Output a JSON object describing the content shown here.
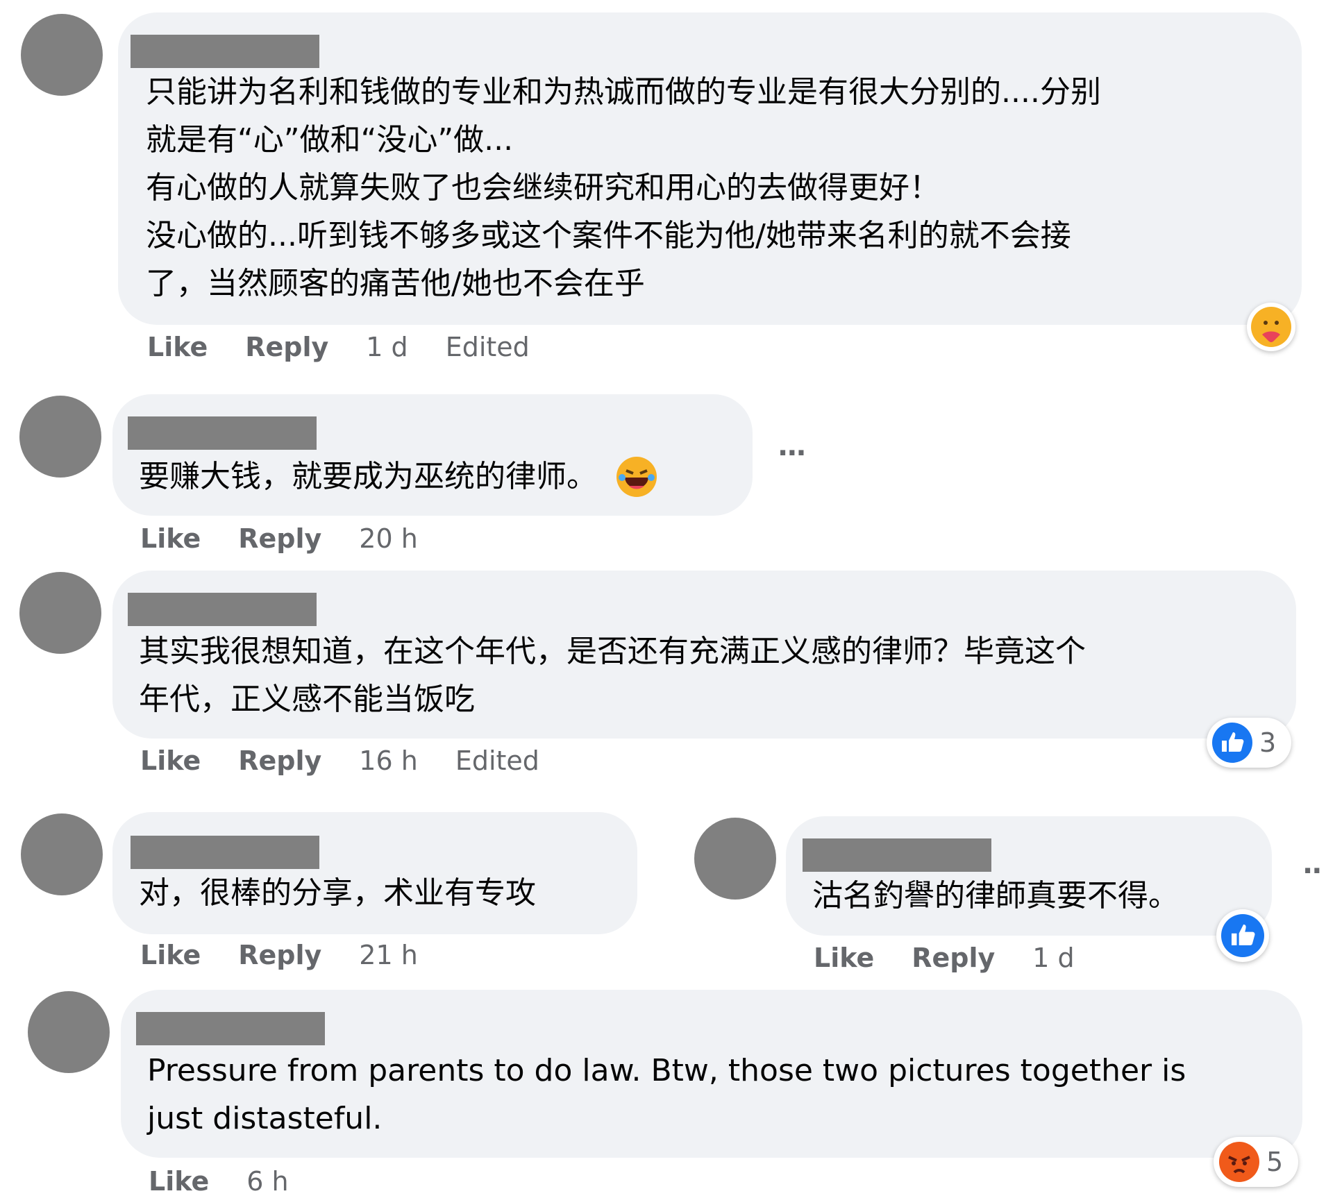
{
  "comments": [
    {
      "text_lines": [
        "只能讲为名利和钱做的专业和为热诚而做的专业是有很大分别的....分别",
        "就是有“心”做和“没心”做...",
        "有心做的人就算失败了也会继续研究和用心的去做得更好！",
        "没心做的...听到钱不够多或这个案件不能为他/她带来名利的就不会接",
        "了，当然顾客的痛苦他/她也不会在乎"
      ],
      "like": "Like",
      "reply": "Reply",
      "time": "1 d",
      "edited": "Edited",
      "reaction_icon": "care-emoji-icon"
    },
    {
      "text_lines": [
        "要赚大钱，就要成为巫统的律师。"
      ],
      "inline_emoji": "laughing-emoji-icon",
      "like": "Like",
      "reply": "Reply",
      "time": "20 h",
      "more": "···"
    },
    {
      "text_lines": [
        "其实我很想知道，在这个年代，是否还有充满正义感的律师？毕竟这个",
        "年代，正义感不能当饭吃"
      ],
      "like": "Like",
      "reply": "Reply",
      "time": "16 h",
      "edited": "Edited",
      "reaction_icon": "like-thumb-icon",
      "reaction_count": "3"
    },
    {
      "text_lines": [
        "对，很棒的分享，术业有专攻"
      ],
      "like": "Like",
      "reply": "Reply",
      "time": "21 h"
    },
    {
      "text_lines": [
        "沽名釣譽的律師真要不得。"
      ],
      "like": "Like",
      "reply": "Reply",
      "time": "1 d",
      "reaction_icon": "like-thumb-icon",
      "more": "··"
    },
    {
      "text_lines": [
        "Pressure from parents to do law. Btw, those two pictures together is",
        "just distasteful."
      ],
      "like": "Like",
      "time": "6 h",
      "reaction_icon": "angry-emoji-icon",
      "reaction_count": "5"
    }
  ],
  "colors": {
    "bubble": "#f0f2f5",
    "redaction": "#808080",
    "meta_text": "#65676b",
    "like_blue": "#1877f2",
    "angry_orange": "#f05a1a",
    "care_yellow": "#f7b125"
  }
}
